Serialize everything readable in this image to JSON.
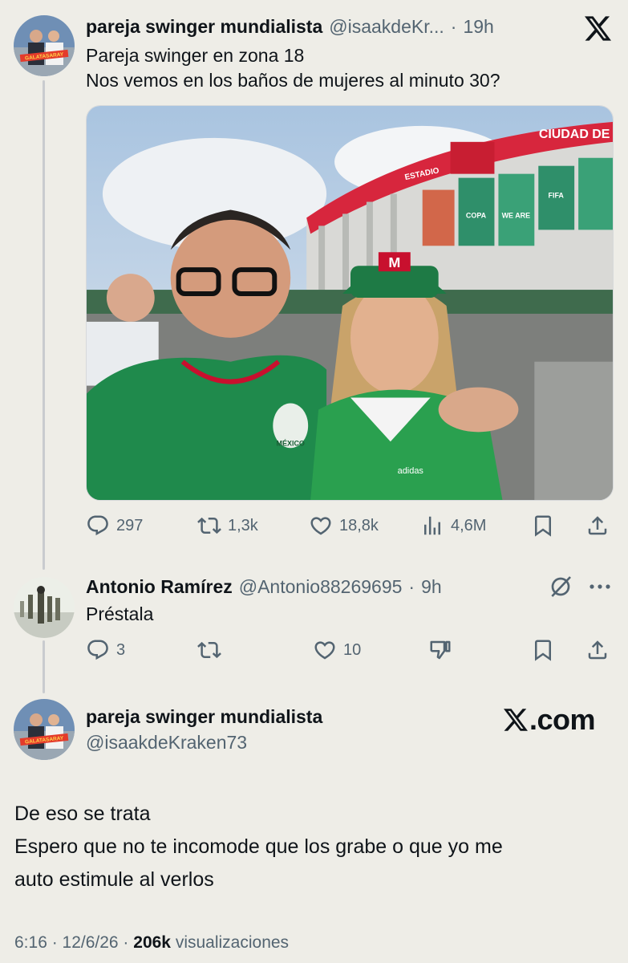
{
  "tweet1": {
    "display_name": "pareja swinger mundialista",
    "handle": "@isaakdeKr...",
    "separator": "·",
    "time": "19h",
    "text_line1": "Pareja swinger en zona 18",
    "text_line2": "Nos vemos en los baños de mujeres al minuto 30?",
    "replies": "297",
    "retweets": "1,3k",
    "likes": "18,8k",
    "views": "4,6M",
    "media": {
      "stadium_sign": "CIUDAD DE",
      "stadium_small": "ESTADIO",
      "banner1": "COPA",
      "banner2": "WE ARE",
      "banner3": "FIFA",
      "jersey_text": "MÉXICO",
      "brand": "adidas",
      "cap_letter": "M"
    }
  },
  "reply": {
    "display_name": "Antonio Ramírez",
    "handle": "@Antonio88269695",
    "separator": "·",
    "time": "9h",
    "text": "Préstala",
    "replies": "3",
    "likes": "10"
  },
  "tweet2": {
    "display_name": "pareja swinger mundialista",
    "handle": "@isaakdeKraken73",
    "text_line1": "De eso se trata",
    "text_line2": "Espero que no te incomode que los grabe o que yo me",
    "text_line3": "auto estimule al verlos",
    "timestamp": "6:16 · 12/6/26 · ",
    "views_count": "206k",
    "views_label": " visualizaciones",
    "brand_label": ".com"
  },
  "avatar_banner": "GALATASARAY",
  "colors": {
    "background": "#eeede7",
    "text": "#0f1419",
    "muted": "#536471",
    "jersey_green": "#1f8a4c"
  }
}
